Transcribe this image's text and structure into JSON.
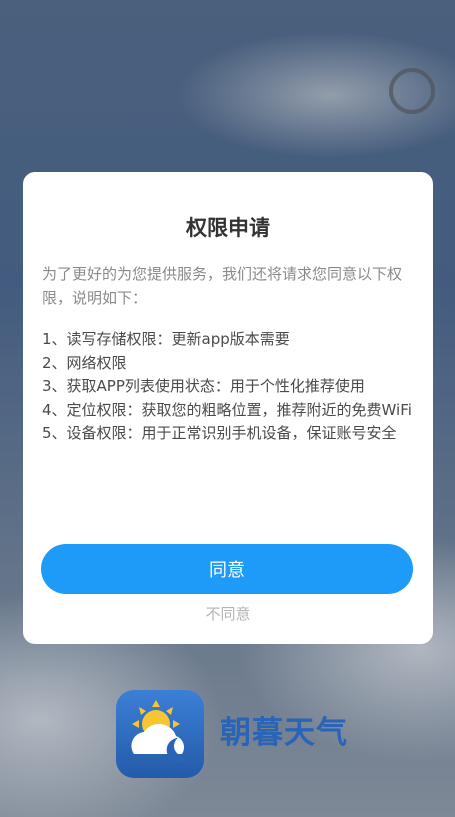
{
  "dialog": {
    "title": "权限申请",
    "intro": "为了更好的为您提供服务，我们还将请求您同意以下权限，说明如下：",
    "items": [
      "1、读写存储权限：更新app版本需要",
      "2、网络权限",
      "3、获取APP列表使用状态：用于个性化推荐使用",
      "4、定位权限：获取您的粗略位置，推荐附近的免费WiFi",
      "5、设备权限：用于正常识别手机设备，保证账号安全"
    ],
    "agree_label": "同意",
    "disagree_label": "不同意"
  },
  "app": {
    "name": "朝暮天气",
    "icon": "weather-sun-cloud-moon-icon"
  },
  "colors": {
    "accent": "#1e9bf8",
    "brand": "#2a64b6"
  }
}
